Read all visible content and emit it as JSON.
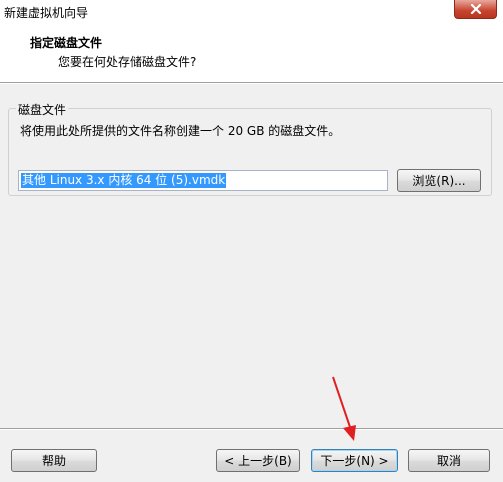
{
  "window": {
    "title": "新建虚拟机向导",
    "close_icon": "close-icon"
  },
  "header": {
    "title": "指定磁盘文件",
    "subtitle": "您要在何处存储磁盘文件?"
  },
  "disk_group": {
    "legend": "磁盘文件",
    "description": "将使用此处所提供的文件名称创建一个 20 GB 的磁盘文件。",
    "file_value": "其他 Linux 3.x 内核 64 位 (5).vmdk",
    "browse_label": "浏览(R)..."
  },
  "footer": {
    "help_label": "帮助",
    "prev_label": "< 上一步(B)",
    "next_label": "下一步(N) >",
    "cancel_label": "取消"
  },
  "colors": {
    "selection": "#3399ff",
    "arrow": "#e02020",
    "close_button": "#c7442e"
  }
}
